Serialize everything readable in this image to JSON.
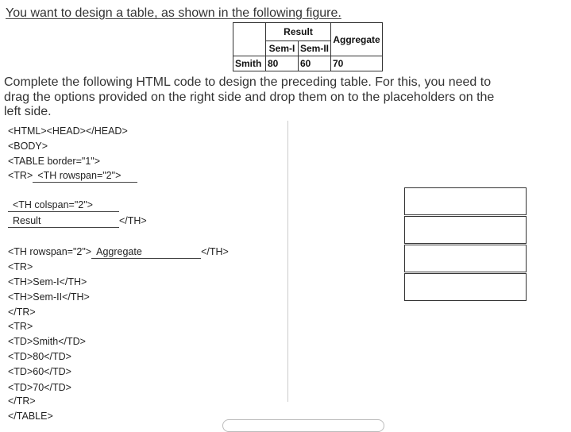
{
  "question": {
    "intro": "You want to design a table, as shown in the following figure.",
    "instructions": "Complete the following HTML code to design the preceding table. For this,  you need to drag the options provided on the right side and drop them on to the placeholders on the left side."
  },
  "figure_table": {
    "result": "Result",
    "aggregate": "Aggregate",
    "sem1": "Sem-I",
    "sem2": "Sem-II",
    "name": "Smith",
    "v1": "80",
    "v2": "60",
    "v3": "70"
  },
  "code": {
    "l1": "<HTML><HEAD></HEAD>",
    "l2": "<BODY>",
    "l3": "<TABLE border=\"1\">",
    "l4_prefix": "<TR>",
    "blank1": "<TH rowspan=\"2\">",
    "blank2": "<TH colspan=\"2\">",
    "blank3": "Result",
    "l6_suffix": "</TH>",
    "l7_prefix": "<TH rowspan=\"2\">",
    "blank4": "Aggregate",
    "l7_suffix": "</TH>",
    "l8": "<TR>",
    "l9": "<TH>Sem-I</TH>",
    "l10": "<TH>Sem-II</TH>",
    "l11": "</TR>",
    "l12": "<TR>",
    "l13": "<TD>Smith</TD>",
    "l14": "<TD>80</TD>",
    "l15": "<TD>60</TD>",
    "l16": "<TD>70</TD>",
    "l17": "</TR>",
    "l18": "</TABLE>"
  }
}
